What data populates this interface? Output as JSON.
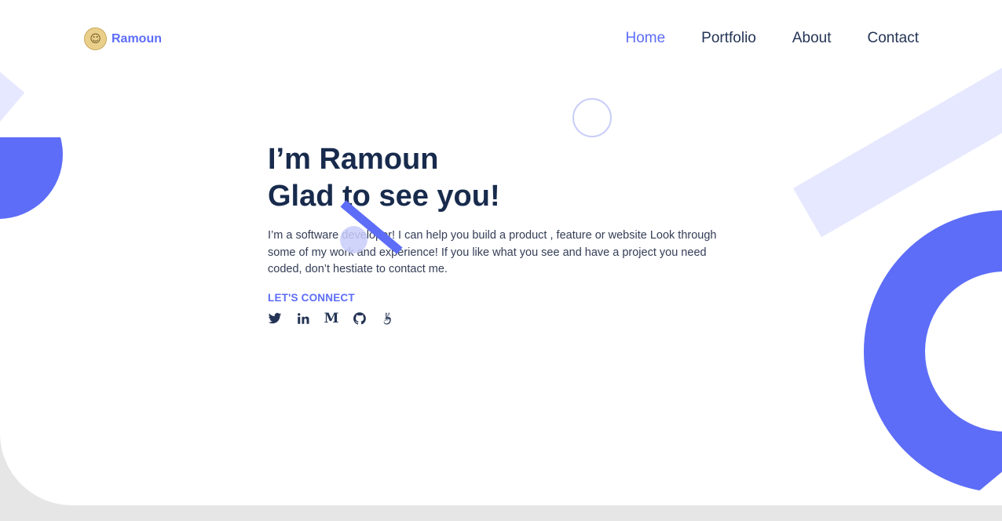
{
  "brand": {
    "name": "Ramoun",
    "avatar_icon": "portrait-avatar"
  },
  "nav": [
    {
      "label": "Home",
      "active": true
    },
    {
      "label": "Portfolio",
      "active": false
    },
    {
      "label": "About",
      "active": false
    },
    {
      "label": "Contact",
      "active": false
    }
  ],
  "hero": {
    "title_line1": "I’m Ramoun",
    "title_line2": "Glad to see you!",
    "description": "I’m a software developer! I can help you build a product , feature or website Look through some of my work and experience! If you like what you see and have a project you need coded, don’t hestiate to contact me.",
    "connect_label": "LET'S CONNECT",
    "socials": [
      {
        "icon": "twitter-icon"
      },
      {
        "icon": "linkedin-icon"
      },
      {
        "icon": "medium-icon"
      },
      {
        "icon": "github-icon"
      },
      {
        "icon": "angellist-icon"
      }
    ]
  },
  "colors": {
    "accent": "#5d6df7",
    "accent_light": "#e6e8ff",
    "heading": "#182b4d",
    "text": "#333d56",
    "background": "#e6e6e6"
  }
}
